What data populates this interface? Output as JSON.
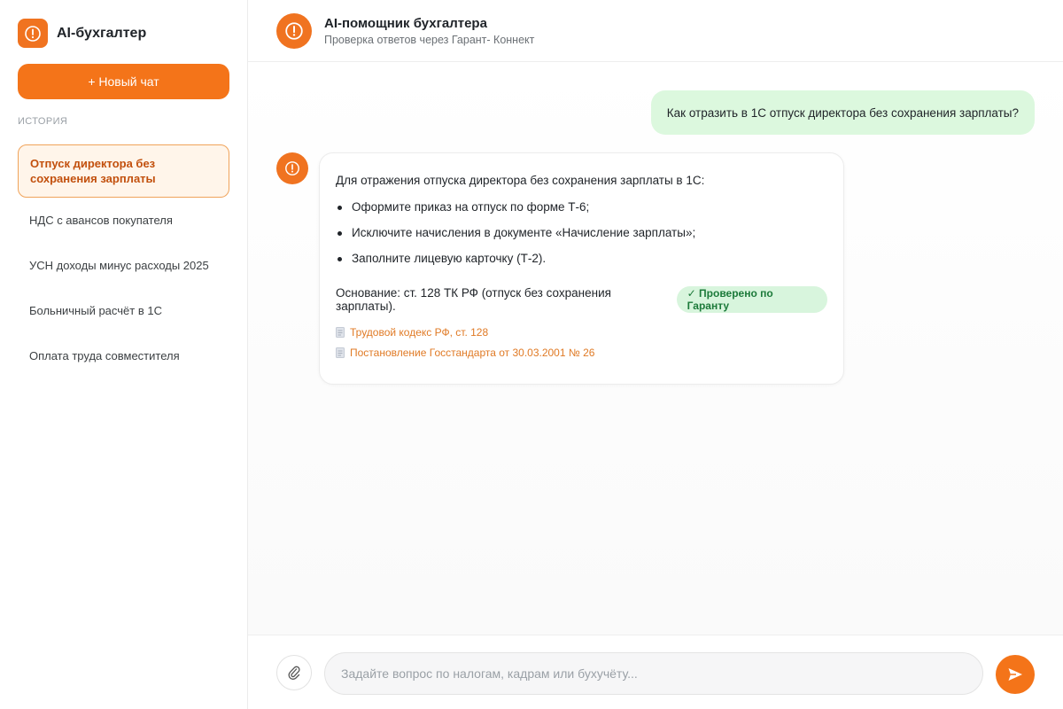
{
  "app": {
    "name": "AI-бухгалтер",
    "accent_color": "#f47419",
    "logo_icon": "alert-circle-icon"
  },
  "sidebar": {
    "new_chat_label": "+ Новый чат",
    "history_title": "ИСТОРИЯ",
    "items": [
      {
        "label": "Отпуск директора без сохранения зарплаты",
        "active": true
      },
      {
        "label": "НДС с авансов покупателя",
        "active": false
      },
      {
        "label": "УСН доходы минус расходы 2025",
        "active": false
      },
      {
        "label": "Больничный расчёт в 1С",
        "active": false
      },
      {
        "label": "Оплата труда совместителя",
        "active": false
      }
    ]
  },
  "header": {
    "title": "AI-помощник бухгалтера",
    "subtitle": "Проверка ответов через Гарант- Коннект"
  },
  "messages": {
    "user": "Как отразить в 1С отпуск директора без сохранения зарплаты?",
    "bot": {
      "intro": "Для отражения отпуска директора без сохранения зарплаты в 1С:",
      "steps": [
        "Оформите приказ на отпуск по форме Т-6;",
        "Исключите начисления в документе «Начисление зарплаты»;",
        "Заполните лицевую карточку (Т-2)."
      ],
      "basis": "Основание: ст. 128 ТК РФ (отпуск без сохранения зарплаты).",
      "verified_badge": "✓ Проверено по Гаранту",
      "verified_color": "#1c7a3a",
      "sources": [
        "Трудовой кодекс РФ, ст. 128",
        "Постановление Госстандарта от 30.03.2001 № 26"
      ]
    }
  },
  "composer": {
    "placeholder": "Задайте вопрос по налогам, кадрам или бухучёту...",
    "value": "",
    "attach_icon": "paperclip-icon",
    "send_icon": "send-icon"
  }
}
